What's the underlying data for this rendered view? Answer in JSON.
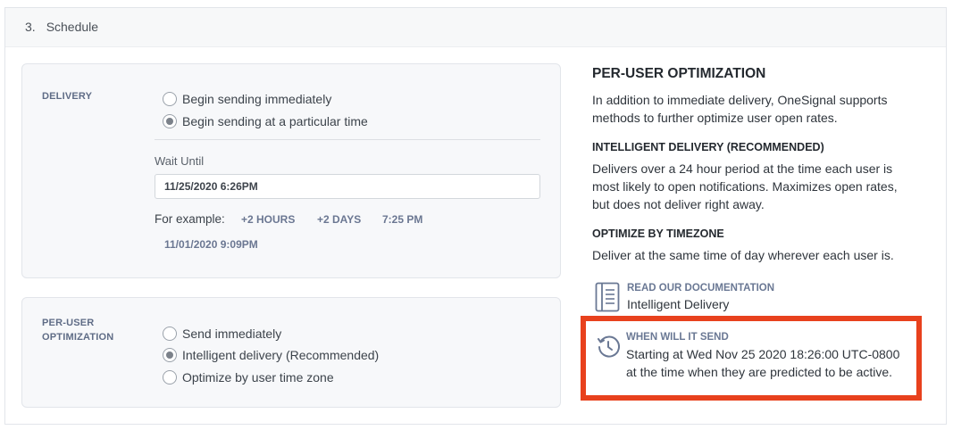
{
  "section": {
    "number": "3.",
    "title": "Schedule"
  },
  "delivery": {
    "label": "DELIVERY",
    "options": [
      {
        "label": "Begin sending immediately",
        "checked": false
      },
      {
        "label": "Begin sending at a particular time",
        "checked": true
      }
    ],
    "wait_until_label": "Wait Until",
    "wait_until_value": "11/25/2020 6:26PM",
    "example_label": "For example:",
    "examples": [
      "+2 HOURS",
      "+2 DAYS",
      "7:25 PM",
      "11/01/2020 9:09PM"
    ]
  },
  "per_user": {
    "label_line1": "PER-USER",
    "label_line2": "OPTIMIZATION",
    "options": [
      {
        "label": "Send immediately",
        "checked": false
      },
      {
        "label": "Intelligent delivery (Recommended)",
        "checked": true
      },
      {
        "label": "Optimize by user time zone",
        "checked": false
      }
    ]
  },
  "info": {
    "title": "PER-USER OPTIMIZATION",
    "intro_line1": "In addition to immediate delivery, OneSignal supports",
    "intro_line2": "methods to further optimize user open rates.",
    "intelligent_title": "INTELLIGENT DELIVERY (RECOMMENDED)",
    "intelligent_line1": "Delivers over a 24 hour period at the time each user is",
    "intelligent_line2": "most likely to open notifications. Maximizes open rates,",
    "intelligent_line3": "but does not deliver right away.",
    "timezone_title": "OPTIMIZE BY TIMEZONE",
    "timezone_text": "Deliver at the same time of day wherever each user is.",
    "doc_link": "READ OUR DOCUMENTATION",
    "doc_sub": "Intelligent Delivery",
    "doc_icon": "document-icon"
  },
  "when": {
    "label": "WHEN WILL IT SEND",
    "line1": "Starting at Wed Nov 25 2020 18:26:00 UTC-0800",
    "line2": "at the time when they are predicted to be active.",
    "icon": "clock-history-icon",
    "highlight_color": "#e8411d"
  }
}
